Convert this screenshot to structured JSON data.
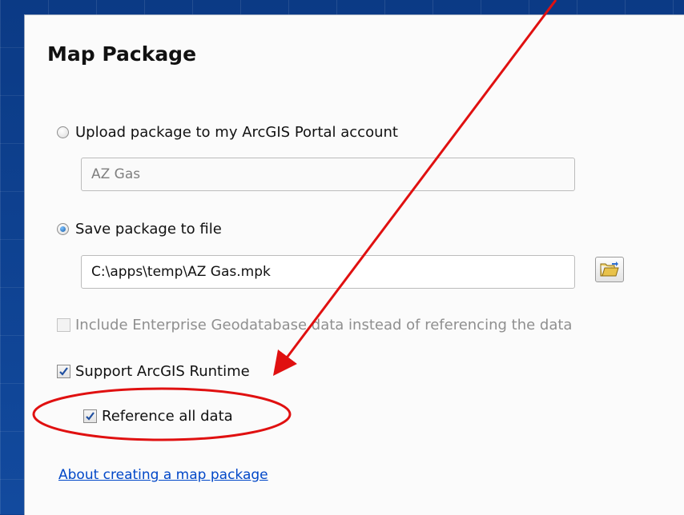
{
  "dialog": {
    "title": "Map Package",
    "upload_option": {
      "label": "Upload package to my ArcGIS Portal account",
      "selected": false
    },
    "upload_name_field": {
      "value": "AZ Gas"
    },
    "save_option": {
      "label": "Save package to file",
      "selected": true
    },
    "save_path_field": {
      "value": "C:\\apps\\temp\\AZ Gas.mpk"
    },
    "browse_button": {
      "icon": "folder-icon"
    },
    "include_enterprise": {
      "label": "Include Enterprise Geodatabase data instead of referencing the data",
      "checked": false,
      "enabled": false
    },
    "support_runtime": {
      "label": "Support ArcGIS Runtime",
      "checked": true
    },
    "reference_all_data": {
      "label": "Reference all data",
      "checked": true
    },
    "help_link": {
      "label": "About creating a map package"
    }
  },
  "annotations": {
    "arrow_color": "#e01010",
    "highlight_ellipse_color": "#e01010"
  }
}
